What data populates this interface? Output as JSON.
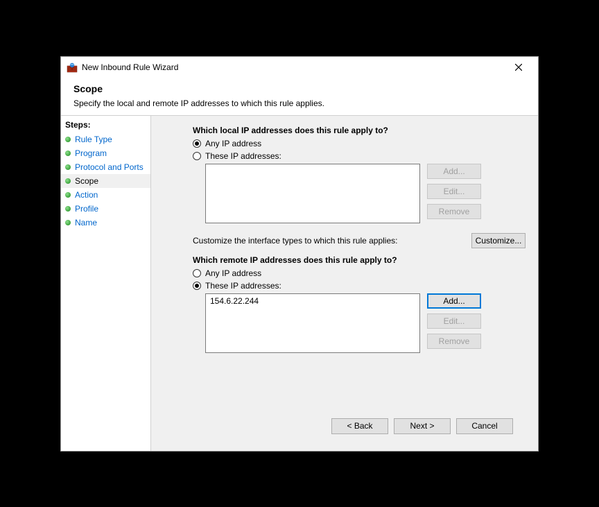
{
  "titlebar": {
    "title": "New Inbound Rule Wizard"
  },
  "header": {
    "heading": "Scope",
    "description": "Specify the local and remote IP addresses to which this rule applies."
  },
  "sidebar": {
    "steps_label": "Steps:",
    "items": [
      {
        "label": "Rule Type",
        "current": false
      },
      {
        "label": "Program",
        "current": false
      },
      {
        "label": "Protocol and Ports",
        "current": false
      },
      {
        "label": "Scope",
        "current": true
      },
      {
        "label": "Action",
        "current": false
      },
      {
        "label": "Profile",
        "current": false
      },
      {
        "label": "Name",
        "current": false
      }
    ]
  },
  "local": {
    "question": "Which local IP addresses does this rule apply to?",
    "any_label": "Any IP address",
    "these_label": "These IP addresses:",
    "selected": "any",
    "entries": [],
    "add_label": "Add...",
    "edit_label": "Edit...",
    "remove_label": "Remove"
  },
  "customize": {
    "text": "Customize the interface types to which this rule applies:",
    "button": "Customize..."
  },
  "remote": {
    "question": "Which remote IP addresses does this rule apply to?",
    "any_label": "Any IP address",
    "these_label": "These IP addresses:",
    "selected": "these",
    "entries": [
      "154.6.22.244"
    ],
    "add_label": "Add...",
    "edit_label": "Edit...",
    "remove_label": "Remove"
  },
  "footer": {
    "back": "< Back",
    "next": "Next >",
    "cancel": "Cancel"
  }
}
